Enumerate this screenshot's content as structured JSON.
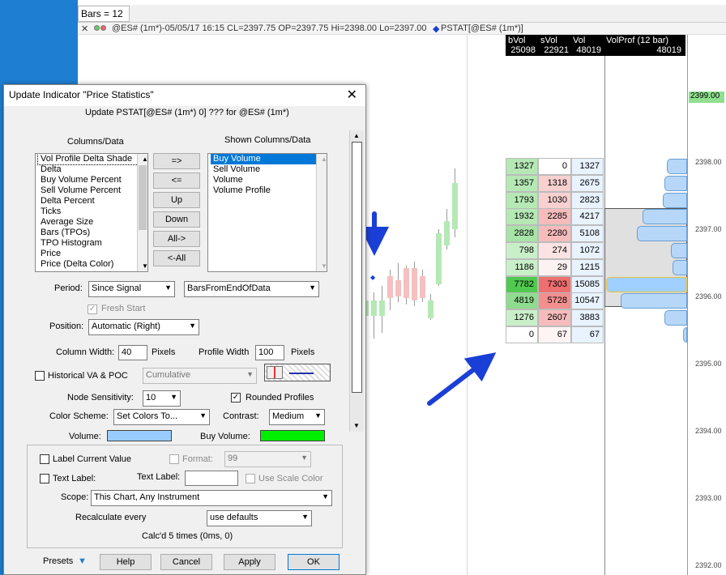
{
  "chart": {
    "bars_box": "Bars = 12",
    "info_line": "@ES# (1m*)-05/05/17 16:15 CL=2397.75 OP=2397.75 Hi=2398.00 Lo=2397.00",
    "indicator_label": "PSTAT[@ES# (1m*)]",
    "columns": [
      "bVol",
      "sVol",
      "Vol",
      "VolProf (12 bar)"
    ],
    "totals": [
      "25098",
      "22921",
      "48019",
      "48019"
    ],
    "rows": [
      {
        "b": "1327",
        "s": "0",
        "v": "1327",
        "bg": "#b5e8b5",
        "sbg": "#ffffff"
      },
      {
        "b": "1357",
        "s": "1318",
        "v": "2675",
        "bg": "#b5e8b5",
        "sbg": "#f8d0d0"
      },
      {
        "b": "1793",
        "s": "1030",
        "v": "2823",
        "bg": "#b5e8b5",
        "sbg": "#f8d0d0"
      },
      {
        "b": "1932",
        "s": "2285",
        "v": "4217",
        "bg": "#b5e8b5",
        "sbg": "#f6bcbc"
      },
      {
        "b": "2828",
        "s": "2280",
        "v": "5108",
        "bg": "#a8e3a8",
        "sbg": "#f6bcbc"
      },
      {
        "b": "798",
        "s": "274",
        "v": "1072",
        "bg": "#c9efc9",
        "sbg": "#fbe3e3"
      },
      {
        "b": "1186",
        "s": "29",
        "v": "1215",
        "bg": "#c9efc9",
        "sbg": "#fdf2f2"
      },
      {
        "b": "7782",
        "s": "7303",
        "v": "15085",
        "bg": "#4fc94f",
        "sbg": "#ee6f6f"
      },
      {
        "b": "4819",
        "s": "5728",
        "v": "10547",
        "bg": "#8fdb8f",
        "sbg": "#f28f8f"
      },
      {
        "b": "1276",
        "s": "2607",
        "v": "3883",
        "bg": "#c9efc9",
        "sbg": "#f6bcbc"
      },
      {
        "b": "0",
        "s": "67",
        "v": "67",
        "bg": "#ffffff",
        "sbg": "#fff4f4"
      }
    ],
    "profile_values": [
      0.25,
      0.28,
      0.3,
      0.55,
      0.62,
      0.2,
      0.18,
      1.0,
      0.82,
      0.28,
      0.05
    ],
    "price_labels": [
      "2399.00",
      "2398.00",
      "2397.00",
      "2396.00",
      "2395.00",
      "2394.00",
      "2393.00",
      "2392.00"
    ],
    "current_price": "2399.00",
    "colors": {
      "accent_blue": "#1e7fd2",
      "buy": "#00ee00",
      "volume": "#99ccff",
      "arrow": "#1a3fd6"
    }
  },
  "dialog": {
    "title": "Update Indicator \"Price Statistics\"",
    "subtitle": "Update PSTAT[@ES# (1m*) 0] ??? for @ES# (1m*)",
    "columns_label": "Columns/Data",
    "shown_label": "Shown Columns/Data",
    "available_items": [
      "Vol Profile Delta Shade",
      "Delta",
      "Buy Volume Percent",
      "Sell Volume Percent",
      "Delta Percent",
      "Ticks",
      "Average Size",
      "Bars (TPOs)",
      "TPO Histogram",
      "Price",
      "Price (Delta Color)"
    ],
    "shown_items": [
      "Buy Volume",
      "Sell Volume",
      "Volume",
      "Volume Profile"
    ],
    "move_buttons": [
      "=>",
      "<=",
      "Up",
      "Down",
      "All->",
      "<-All"
    ],
    "period_label": "Period:",
    "period_value": "Since Signal",
    "period2_value": "BarsFromEndOfData",
    "fresh_start": "Fresh Start",
    "position_label": "Position:",
    "position_value": "Automatic (Right)",
    "col_width_label": "Column Width:",
    "col_width_value": "40",
    "pixels1": "Pixels",
    "profile_width_label": "Profile Width",
    "profile_width_value": "100",
    "pixels2": "Pixels",
    "hist_label": "Historical VA & POC",
    "hist_value": "Cumulative",
    "node_label": "Node Sensitivity:",
    "node_value": "10",
    "rounded_label": "Rounded Profiles",
    "scheme_label": "Color Scheme:",
    "scheme_value": "Set Colors To...",
    "contrast_label": "Contrast:",
    "contrast_value": "Medium",
    "volume_label": "Volume:",
    "buy_volume_label": "Buy Volume:",
    "label_current": "Label Current Value",
    "format_label": "Format:",
    "format_value": "99",
    "text_label_cb": "Text Label:",
    "text_label_label": "Text Label:",
    "text_label_value": "",
    "use_scale": "Use Scale Color",
    "scope_label": "Scope:",
    "scope_value": "This Chart, Any Instrument",
    "recalc_label": "Recalculate every",
    "recalc_value": "use defaults",
    "calc_status": "Calc'd 5 times (0ms, 0)",
    "presets": "Presets",
    "help": "Help",
    "cancel": "Cancel",
    "apply": "Apply",
    "ok": "OK"
  }
}
